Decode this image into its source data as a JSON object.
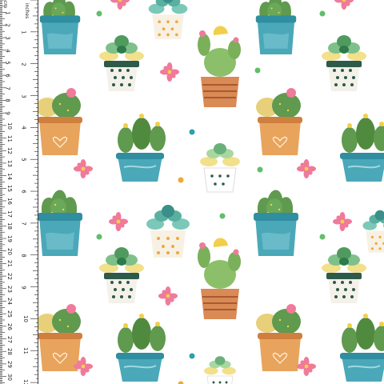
{
  "ruler": {
    "cm_unit": "cm",
    "inch_unit": "inches",
    "cm_labels": [
      "1",
      "2",
      "3",
      "4",
      "5",
      "6",
      "7",
      "8",
      "9",
      "10",
      "11",
      "12",
      "13",
      "14",
      "15",
      "16",
      "17",
      "18",
      "19",
      "20",
      "21",
      "22",
      "23",
      "24",
      "25",
      "26",
      "27",
      "28",
      "29",
      "30"
    ],
    "inch_labels": [
      "1",
      "2",
      "3",
      "4",
      "5",
      "6",
      "7",
      "8",
      "9",
      "10",
      "11",
      "12"
    ]
  },
  "motifs": {
    "A": "blue-pot-cactus-icon",
    "B": "dotted-pot-succulent-icon",
    "C": "striped-pot-cactus-icon",
    "D": "orange-pot-cactus-icon",
    "E": "blue-bowl-cactus-icon",
    "F": "white-dotted-pot-succulent-icon",
    "G": "orange-dotted-pot-succulent-icon",
    "flower": "pink-flower-icon",
    "dot": "confetti-dot-icon"
  },
  "colors": {
    "cactus": "#5f9a4e",
    "cactus_dark": "#3f7a3a",
    "teal_pot": "#4aa8b8",
    "terracotta": "#e0a26a",
    "pink": "#f07a9a",
    "yellow": "#f2cf4a",
    "dots_green": "#5fbf6a",
    "dots_teal": "#2aa0b0",
    "dots_orange": "#f0a83a"
  }
}
